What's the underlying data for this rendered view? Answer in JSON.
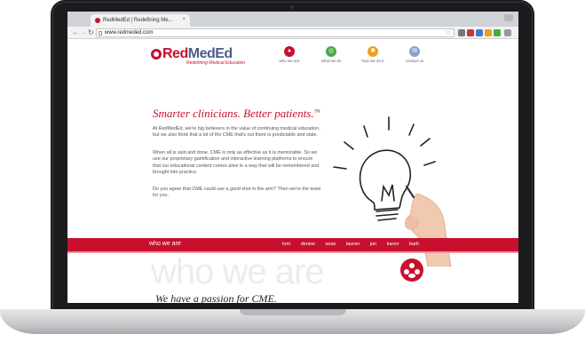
{
  "browser": {
    "tab_title": "RedMedEd | Redefining Me...",
    "tab_close": "×",
    "url": "www.redmeded.com"
  },
  "site": {
    "logo": {
      "red": "Red",
      "blue": "MedEd",
      "tagline": "Redefining Medical Education"
    },
    "nav": [
      {
        "label": "who we are",
        "color": "#c8102e",
        "icon": "people-icon",
        "glyph": "●"
      },
      {
        "label": "what we do",
        "color": "#4aa84a",
        "icon": "target-icon",
        "glyph": "◎"
      },
      {
        "label": "how we do it",
        "color": "#f0a020",
        "icon": "lightbulb-icon",
        "glyph": "✺"
      },
      {
        "label": "contact us",
        "color": "#8aa0d0",
        "icon": "envelope-icon",
        "glyph": "✉"
      }
    ],
    "hero": {
      "title": "Smarter clinicians. Better patients.",
      "tm": "TM",
      "paragraphs": [
        "At RedMedEd, we're big believers in the value of continuing medical education, but we also think that a lot of the CME that's out there is predictable and stale.",
        "When all is said and done, CME is only as effective as it is memorable. So we use our proprietary gamification and interactive learning platforms to ensure that our educational content comes alive in a way that will be remembered and brought into practice.",
        "Do you agree that CME could use a good shot in the arm? Then we're the team for you."
      ]
    },
    "section_bar": {
      "title": "who we are",
      "people": [
        "tom",
        "denise",
        "sean",
        "lauren",
        "jon",
        "karen",
        "barb"
      ]
    },
    "watermark": "who we are",
    "passion_heading": "We have a passion for CME."
  },
  "colors": {
    "brand_red": "#c8102e",
    "brand_blue": "#4b5d8a"
  }
}
